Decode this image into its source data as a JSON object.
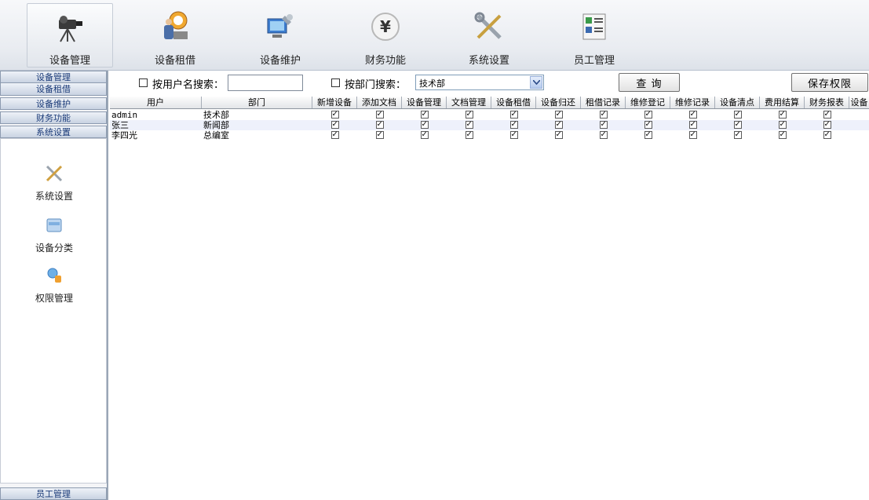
{
  "toolbar": {
    "items": [
      {
        "label": "设备管理",
        "icon": "camera-tripod-icon"
      },
      {
        "label": "设备租借",
        "icon": "projector-person-icon"
      },
      {
        "label": "设备维护",
        "icon": "computer-wrench-icon"
      },
      {
        "label": "财务功能",
        "icon": "yen-icon"
      },
      {
        "label": "系统设置",
        "icon": "tools-icon"
      },
      {
        "label": "员工管理",
        "icon": "id-card-icon"
      }
    ]
  },
  "sidebar": {
    "headers": [
      "设备管理",
      "设备租借",
      "设备维护",
      "财务功能",
      "系统设置"
    ],
    "items": [
      {
        "label": "系统设置",
        "icon": "tools-icon"
      },
      {
        "label": "设备分类",
        "icon": "folder-icon"
      },
      {
        "label": "权限管理",
        "icon": "key-user-icon"
      }
    ],
    "bottom_label": "员工管理"
  },
  "search": {
    "by_user_label": "按用户名搜索：",
    "by_user_value": "",
    "by_dept_label": "按部门搜索：",
    "dept_selected": "技术部",
    "query_button": "查 询",
    "save_button": "保存权限"
  },
  "table": {
    "columns": [
      "用户",
      "部门",
      "新增设备",
      "添加文档",
      "设备管理",
      "文档管理",
      "设备租借",
      "设备归还",
      "租借记录",
      "维修登记",
      "维修记录",
      "设备清点",
      "费用结算",
      "财务报表",
      "设备"
    ],
    "rows": [
      {
        "user": "admin",
        "dept": "技术部",
        "perms": [
          true,
          true,
          true,
          true,
          true,
          true,
          true,
          true,
          true,
          true,
          true,
          true
        ]
      },
      {
        "user": "张三",
        "dept": "新闻部",
        "perms": [
          true,
          true,
          true,
          true,
          true,
          true,
          true,
          true,
          true,
          true,
          true,
          true
        ]
      },
      {
        "user": "李四光",
        "dept": "总编室",
        "perms": [
          true,
          true,
          true,
          true,
          true,
          true,
          true,
          true,
          true,
          true,
          true,
          true
        ]
      }
    ]
  },
  "colors": {
    "accent": "#1a3a78",
    "row_alt": "#eef1fb"
  }
}
